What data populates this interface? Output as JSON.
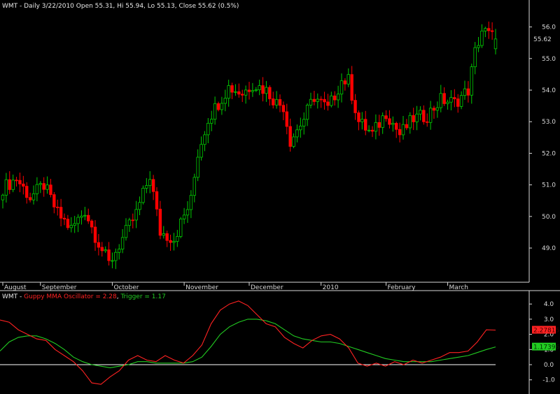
{
  "chart_data": [
    {
      "type": "candlestick",
      "title": "WMT - Daily 3/22/2010 Open 55.31, Hi 55.94, Lo 55.13, Close 55.62 (0.5%)",
      "last_price_label": "55.62",
      "last_price": 55.62,
      "y_ticks": [
        "56.0",
        "55.0",
        "54.0",
        "53.0",
        "52.0",
        "51.0",
        "50.0",
        "49.0"
      ],
      "ylim": [
        48.05,
        56.5
      ],
      "x_labels": [
        {
          "label": "August",
          "index": 0
        },
        {
          "label": "September",
          "index": 11
        },
        {
          "label": "October",
          "index": 32
        },
        {
          "label": "November",
          "index": 53
        },
        {
          "label": "December",
          "index": 72
        },
        {
          "label": "2010",
          "index": 93
        },
        {
          "label": "February",
          "index": 112
        },
        {
          "label": "March",
          "index": 130
        }
      ],
      "grid": false,
      "colors": {
        "up": "#00cc00",
        "down": "#ff0000",
        "background": "#000000",
        "axis": "#d8d8d8"
      },
      "anchors": [
        [
          0,
          50.9
        ],
        [
          4,
          51.2
        ],
        [
          8,
          50.6
        ],
        [
          12,
          51.0
        ],
        [
          16,
          50.1
        ],
        [
          20,
          49.6
        ],
        [
          24,
          50.2
        ],
        [
          27,
          49.4
        ],
        [
          31,
          48.5
        ],
        [
          35,
          49.3
        ],
        [
          39,
          50.1
        ],
        [
          43,
          51.3
        ],
        [
          46,
          49.5
        ],
        [
          50,
          49.3
        ],
        [
          55,
          50.5
        ],
        [
          57,
          52.0
        ],
        [
          60,
          53.1
        ],
        [
          63,
          53.6
        ],
        [
          66,
          54.1
        ],
        [
          70,
          53.9
        ],
        [
          73,
          54.2
        ],
        [
          77,
          54.0
        ],
        [
          80,
          53.6
        ],
        [
          82,
          53.5
        ],
        [
          84,
          52.4
        ],
        [
          88,
          53.1
        ],
        [
          91,
          53.8
        ],
        [
          95,
          53.4
        ],
        [
          99,
          54.3
        ],
        [
          101,
          54.3
        ],
        [
          104,
          53.0
        ],
        [
          108,
          52.6
        ],
        [
          112,
          53.3
        ],
        [
          116,
          52.6
        ],
        [
          120,
          53.1
        ],
        [
          124,
          53.2
        ],
        [
          128,
          53.7
        ],
        [
          132,
          53.6
        ],
        [
          136,
          54.0
        ],
        [
          138,
          55.2
        ],
        [
          140,
          55.9
        ],
        [
          144,
          55.62
        ]
      ],
      "last_candle": {
        "open": 55.31,
        "high": 55.94,
        "low": 55.13,
        "close": 55.62
      }
    },
    {
      "type": "line",
      "title_prefix": "WMT - ",
      "series": [
        {
          "name": "Guppy MMA Oscillator",
          "label": "Guppy MMA Oscillator = 2.28",
          "last_value_label": "2.27815",
          "color": "#ff2222",
          "values": [
            2.95,
            2.8,
            2.3,
            2.0,
            1.7,
            1.6,
            1.0,
            0.6,
            0.2,
            -0.4,
            -1.2,
            -1.3,
            -0.8,
            -0.4,
            0.3,
            0.6,
            0.3,
            0.2,
            0.6,
            0.3,
            0.1,
            0.6,
            1.3,
            2.7,
            3.6,
            4.0,
            4.2,
            3.9,
            3.3,
            2.7,
            2.5,
            1.8,
            1.4,
            1.1,
            1.6,
            1.9,
            2.0,
            1.7,
            1.1,
            0.1,
            -0.1,
            0.1,
            -0.1,
            0.2,
            0.0,
            0.3,
            0.1,
            0.3,
            0.5,
            0.8,
            0.8,
            0.9,
            1.5,
            2.3,
            2.28
          ]
        },
        {
          "name": "Trigger",
          "label": "Trigger = 1.17",
          "last_value_label": "1.17396",
          "color": "#22cc22",
          "values": [
            0.9,
            1.5,
            1.8,
            1.9,
            1.9,
            1.7,
            1.4,
            1.0,
            0.5,
            0.2,
            0.0,
            -0.1,
            -0.2,
            -0.1,
            0.0,
            0.2,
            0.2,
            0.1,
            0.1,
            0.1,
            0.1,
            0.2,
            0.5,
            1.2,
            2.0,
            2.5,
            2.8,
            3.0,
            3.0,
            2.9,
            2.7,
            2.3,
            1.9,
            1.7,
            1.6,
            1.5,
            1.5,
            1.4,
            1.2,
            1.0,
            0.8,
            0.6,
            0.4,
            0.3,
            0.2,
            0.2,
            0.2,
            0.2,
            0.3,
            0.4,
            0.5,
            0.6,
            0.8,
            1.0,
            1.17
          ]
        }
      ],
      "zero_line_color": "#ffffff",
      "y_ticks": [
        "4.0",
        "3.0",
        "2.0",
        "1.0",
        "0.0",
        "-1.0"
      ],
      "ylim": [
        -1.75,
        4.7
      ]
    }
  ]
}
